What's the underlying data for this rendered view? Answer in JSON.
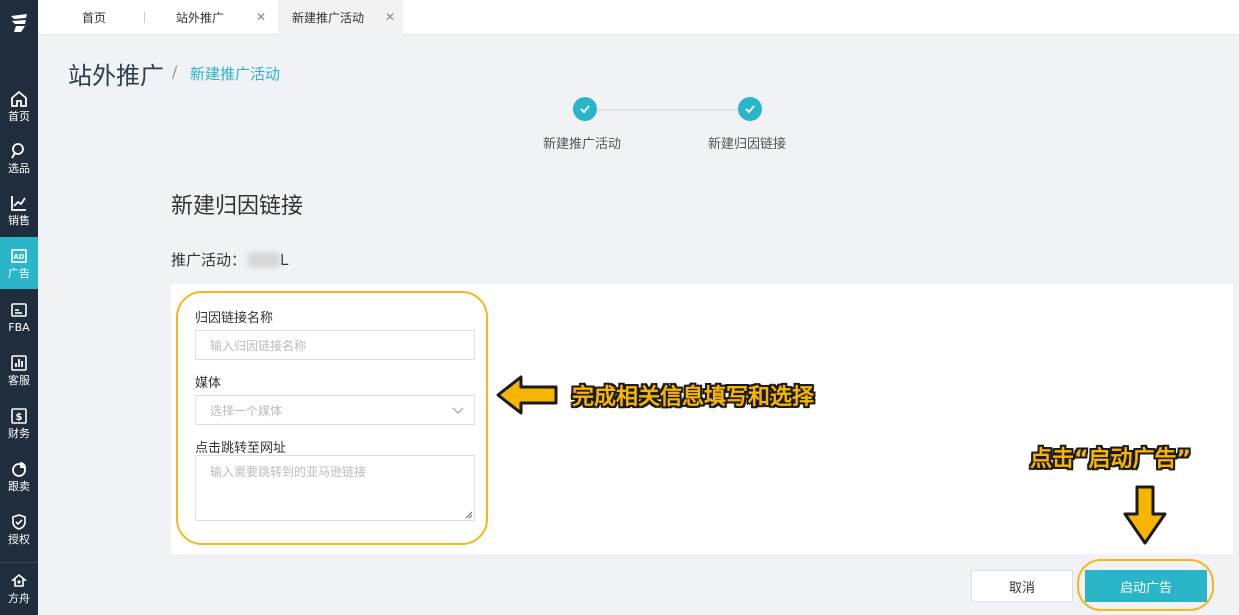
{
  "sidebar": {
    "items": [
      {
        "label": "首页",
        "icon": "home-icon"
      },
      {
        "label": "选品",
        "icon": "search-icon"
      },
      {
        "label": "销售",
        "icon": "chart-icon"
      },
      {
        "label": "广告",
        "icon": "ad-icon",
        "active": true
      },
      {
        "label": "FBA",
        "icon": "fba-icon"
      },
      {
        "label": "客服",
        "icon": "service-icon"
      },
      {
        "label": "财务",
        "icon": "finance-icon"
      },
      {
        "label": "跟卖",
        "icon": "pie-icon"
      },
      {
        "label": "授权",
        "icon": "shield-icon"
      },
      {
        "label": "方舟",
        "icon": "ark-icon"
      }
    ]
  },
  "tabs": [
    {
      "label": "首页",
      "closable": false
    },
    {
      "label": "站外推广",
      "closable": true
    },
    {
      "label": "新建推广活动",
      "closable": true,
      "active": true
    }
  ],
  "header": {
    "title": "站外推广",
    "separator": "/",
    "breadcrumb": "新建推广活动"
  },
  "steps": [
    {
      "label": "新建推广活动",
      "done": true
    },
    {
      "label": "新建归因链接",
      "done": true
    }
  ],
  "section_title": "新建归因链接",
  "campaign": {
    "label": "推广活动：",
    "suffix": "L"
  },
  "form": {
    "name_label": "归因链接名称",
    "name_placeholder": "输入归因链接名称",
    "media_label": "媒体",
    "media_placeholder": "选择一个媒体",
    "url_label": "点击跳转至网址",
    "url_placeholder": "输入需要跳转到的亚马逊链接"
  },
  "annotations": {
    "fill_hint": "完成相关信息填写和选择",
    "click_hint": "点击“启动广告”"
  },
  "buttons": {
    "cancel": "取消",
    "start": "启动广告"
  },
  "colors": {
    "accent": "#2ab5c8",
    "sidebar": "#1f2d3d",
    "highlight": "#f5b81c"
  }
}
